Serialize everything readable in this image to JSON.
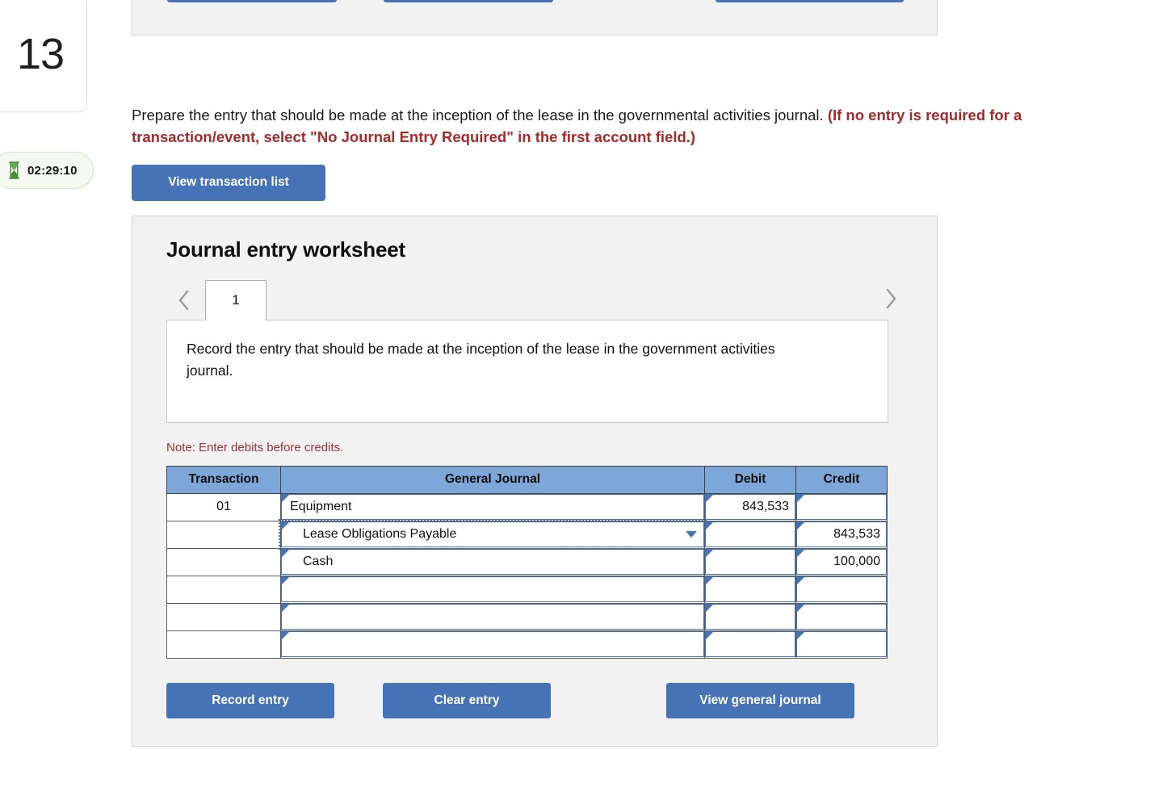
{
  "left_rail": {
    "question_number": "13",
    "timer": {
      "icon": "hourglass-icon",
      "value": "02:29:10"
    }
  },
  "question": {
    "text_plain": "Prepare the entry that should be made at the inception of the lease in the governmental activities journal.",
    "text_emphasis": "(If no entry is required for a transaction/event, select \"No Journal Entry Required\" in the first account field.)",
    "view_transaction_list_label": "View transaction list"
  },
  "worksheet": {
    "title": "Journal entry worksheet",
    "pager": {
      "prev_icon": "chevron-left-icon",
      "next_icon": "chevron-right-icon"
    },
    "tabs": [
      {
        "label": "1",
        "active": true
      }
    ],
    "instruction": "Record the entry that should be made at the inception of the lease in the government activities journal.",
    "note": "Note: Enter debits before credits.",
    "table": {
      "headers": [
        "Transaction",
        "General Journal",
        "Debit",
        "Credit"
      ],
      "rows": [
        {
          "transaction": "01",
          "account": "Equipment",
          "debit": "843,533",
          "credit": "",
          "indent": false,
          "selected": false,
          "dropdown_icon": ""
        },
        {
          "transaction": "",
          "account": "Lease Obligations Payable",
          "debit": "",
          "credit": "843,533",
          "indent": true,
          "selected": true,
          "dropdown_icon": "chevron-down-icon"
        },
        {
          "transaction": "",
          "account": "Cash",
          "debit": "",
          "credit": "100,000",
          "indent": true,
          "selected": false,
          "dropdown_icon": ""
        },
        {
          "transaction": "",
          "account": "",
          "debit": "",
          "credit": "",
          "indent": false,
          "selected": false,
          "dropdown_icon": ""
        },
        {
          "transaction": "",
          "account": "",
          "debit": "",
          "credit": "",
          "indent": false,
          "selected": false,
          "dropdown_icon": ""
        },
        {
          "transaction": "",
          "account": "",
          "debit": "",
          "credit": "",
          "indent": false,
          "selected": false,
          "dropdown_icon": ""
        }
      ]
    },
    "actions": {
      "record_entry_label": "Record entry",
      "clear_entry_label": "Clear entry",
      "view_general_journal_label": "View general journal"
    }
  },
  "colors": {
    "button_blue": "#4573b5",
    "table_header_blue": "#7da7d9",
    "emphasis_red": "#a52a2a",
    "note_red": "#a03030",
    "panel_gray": "#f2f2f2",
    "timer_green": "#4c8a3f"
  }
}
